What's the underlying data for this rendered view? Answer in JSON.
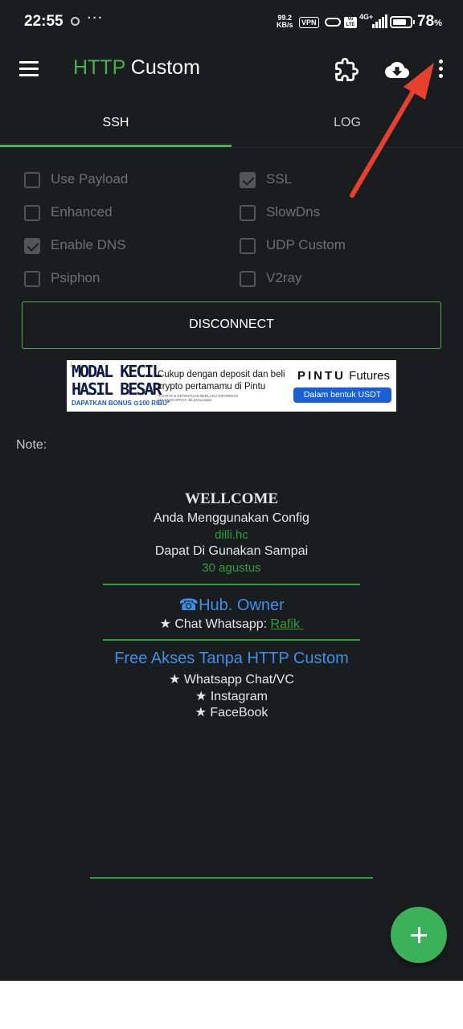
{
  "status_bar": {
    "time": "22:55",
    "more": "···",
    "speed_value": "99.2",
    "speed_unit": "KB/s",
    "vpn_badge": "VPN",
    "volte_top": "Vo",
    "volte_bottom": "LTE",
    "network": "4G+",
    "battery_percent": "78",
    "battery_unit": "%",
    "battery_level": 0.78
  },
  "toolbar": {
    "title_accent": "HTTP",
    "title_rest": " Custom",
    "icons": [
      "menu-icon",
      "puzzle-icon",
      "cloud-download-icon",
      "more-vert-icon"
    ]
  },
  "tabs": [
    {
      "label": "SSH",
      "active": true
    },
    {
      "label": "LOG",
      "active": false
    }
  ],
  "options": [
    {
      "label": "Use Payload",
      "checked": false
    },
    {
      "label": "SSL",
      "checked": true
    },
    {
      "label": "Enhanced",
      "checked": false
    },
    {
      "label": "SlowDns",
      "checked": false
    },
    {
      "label": "Enable DNS",
      "checked": true
    },
    {
      "label": "UDP Custom",
      "checked": false
    },
    {
      "label": "Psiphon",
      "checked": false
    },
    {
      "label": "V2ray",
      "checked": false
    }
  ],
  "connect_button": "DISCONNECT",
  "ad": {
    "headline_1": "MODAL KECIL",
    "headline_2": "HASIL BESAR",
    "bonus": "DAPATKAN BONUS ⊙100 RIBU*",
    "text": "Cukup dengan deposit dan beli crypto pertamamu di Pintu",
    "fine_print": "*SYARAT & KETENTUAN BERLAKU INFORMASI SELENGKAPNYA: bit.ly/nuyoapin",
    "brand_1": "PINTU",
    "brand_2": " Futures",
    "cta": "Dalam bentuk USDT",
    "info": "i"
  },
  "note_label": "Note:",
  "message": {
    "welcome": "WELLCOME",
    "line1": "Anda Menggunakan Config",
    "config_name": "dilli.hc",
    "line2": "Dapat Di Gunakan Sampai",
    "expiry": "30 agustus",
    "owner_title": "☎Hub. Owner",
    "chat_prefix": "★ Chat Whatsapp: ",
    "chat_link": "Rafik ",
    "free_title": "Free Akses Tanpa HTTP Custom",
    "free_items": [
      "★ Whatsapp Chat/VC",
      "★ Instagram",
      "★ FaceBook"
    ]
  },
  "colors": {
    "background": "#1a1d20",
    "accent_green": "#4caf50",
    "link_blue": "#3f8fe8",
    "arrow_red": "#e8402e"
  }
}
